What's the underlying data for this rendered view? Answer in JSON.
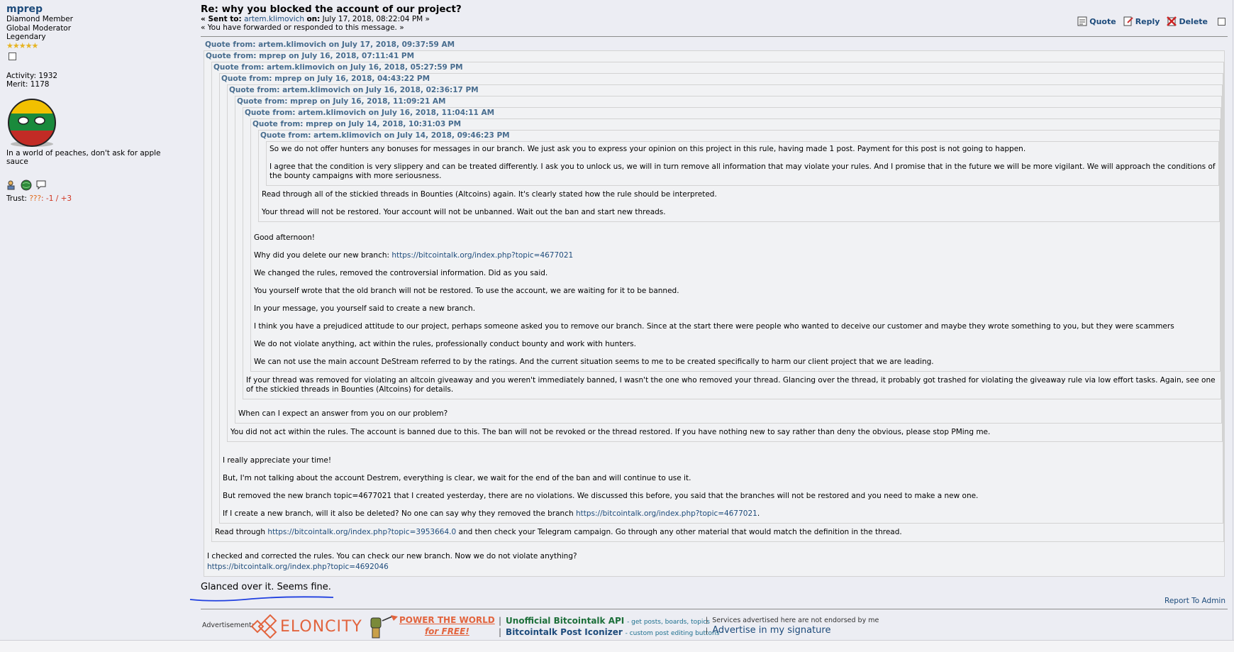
{
  "poster": {
    "username": "mprep",
    "ranks": [
      "Diamond Member",
      "Global Moderator",
      "Legendary"
    ],
    "stars": "★★★★★",
    "activity_label": "Activity: 1932",
    "merit_label": "Merit: 1178",
    "signature": "In a world of peaches, don't ask for apple sauce",
    "trust_label": "Trust:",
    "trust_q": "???",
    "trust_neg": ": -1 / +3"
  },
  "post": {
    "subject": "Re: why you blocked the account of our project?",
    "sent_to_label": "« Sent to:",
    "sent_to_user": "artem.klimovich",
    "sent_on_label": "on:",
    "sent_on": "July 17, 2018, 08:22:04 PM »",
    "forwarded": "« You have forwarded or responded to this message. »",
    "actions": {
      "quote": "Quote",
      "reply": "Reply",
      "delete": "Delete"
    },
    "reply_text": "Glanced over it. Seems fine.",
    "report": "Report To Admin"
  },
  "quotes": {
    "q1": "Quote from: artem.klimovich on July 17, 2018, 09:37:59 AM",
    "q2": "Quote from: mprep on July 16, 2018, 07:11:41 PM",
    "q3": "Quote from: artem.klimovich on July 16, 2018, 05:27:59 PM",
    "q4": "Quote from: mprep on July 16, 2018, 04:43:22 PM",
    "q5": "Quote from: artem.klimovich on July 16, 2018, 02:36:17 PM",
    "q6": "Quote from: mprep on July 16, 2018, 11:09:21 AM",
    "q7": "Quote from: artem.klimovich on July 16, 2018, 11:04:11 AM",
    "q8": "Quote from: mprep on July 14, 2018, 10:31:03 PM",
    "q9": "Quote from: artem.klimovich on July 14, 2018, 09:46:23 PM",
    "t9a": "So we do not offer hunters any bonuses for messages in our branch. We just ask you to express your opinion on this project in this rule, having made 1 post. Payment for this post is not going to happen.",
    "t9b": "I agree that the condition is very slippery and can be treated differently. I ask you to unlock us, we will in turn remove all information that may violate your rules. And I promise that in the future we will be more vigilant. We will approach the conditions of the bounty campaigns with more seriousness.",
    "t8a": "Read through all of the stickied threads in Bounties (Altcoins) again. It's clearly stated how the rule should be interpreted.",
    "t8b": "Your thread will not be restored. Your account will not be unbanned. Wait out the ban and start new threads.",
    "t7a": "Good afternoon!",
    "t7b": "Why did you delete our new branch:",
    "t7b_link": "https://bitcointalk.org/index.php?topic=4677021",
    "t7c": "We changed the rules, removed the controversial information. Did as you said.",
    "t7d": "You yourself wrote that the old branch will not be restored. To use the account, we are waiting for it to be banned.",
    "t7e": "In your message, you yourself said to create a new branch.",
    "t7f": "I think you have a prejudiced attitude to our project, perhaps someone asked you to remove our branch. Since at the start there were people who wanted to deceive our customer and maybe they wrote something to you, but they were scammers",
    "t7g": "We do not violate anything, act within the rules, professionally conduct bounty and work with hunters.",
    "t7h": "We can not use the main account DeStream referred to by the ratings. And the current situation seems to me to be created specifically to harm our client project that we are leading.",
    "t6a": "If your thread was removed for violating an altcoin giveaway and you weren't immediately banned, I wasn't the one who removed your thread. Glancing over the thread, it probably got trashed for violating the giveaway rule via low effort tasks. Again, see one of the stickied threads in Bounties (Altcoins) for details.",
    "t5a": "When can I expect an answer from you on our problem?",
    "t4a": "You did not act within the rules. The account is banned due to this. The ban will not be revoked or the thread restored. If you have nothing new to say rather than deny the obvious, please stop PMing me.",
    "t3a": "I really appreciate your time!",
    "t3b": "But, I'm not talking about the account Destrem, everything is clear, we wait for the end of the ban and will continue to use it.",
    "t3c": "But removed the new branch topic=4677021 that I created yesterday, there are no violations. We discussed this before, you said that the branches will not be restored and you need to make a new one.",
    "t3d": "If I create a new branch, will it also be deleted? No one can say why they removed the branch",
    "t3d_link": "https://bitcointalk.org/index.php?topic=4677021",
    "t3d_end": ".",
    "t2a": "Read through",
    "t2a_link": "https://bitcointalk.org/index.php?topic=3953664.0",
    "t2a_end": "and then check your Telegram campaign. Go through any other material that would match the definition in the thread.",
    "t1a": "I checked and corrected the rules. You can check our new branch. Now we do not violate anything?",
    "t1a_link": "https://bitcointalk.org/index.php?topic=4692046"
  },
  "ad": {
    "label": "Advertisement:",
    "brand": "ELONCITY",
    "power_line1": "POWER THE WORLD",
    "power_line2": "for FREE!",
    "link1_title": "Unofficial Bitcointalk API",
    "link1_desc": "- get posts, boards, topics",
    "link2_title": "Bitcointalk Post Iconizer",
    "link2_desc": "- custom post editing buttons",
    "disclaimer": "Services advertised here are not endorsed by me",
    "advertise": "Advertise in my signature"
  },
  "colors": {
    "link": "#1d4b7b",
    "quote_header": "#476c8e",
    "brand": "#e2643e",
    "bg": "#ecedf3"
  }
}
